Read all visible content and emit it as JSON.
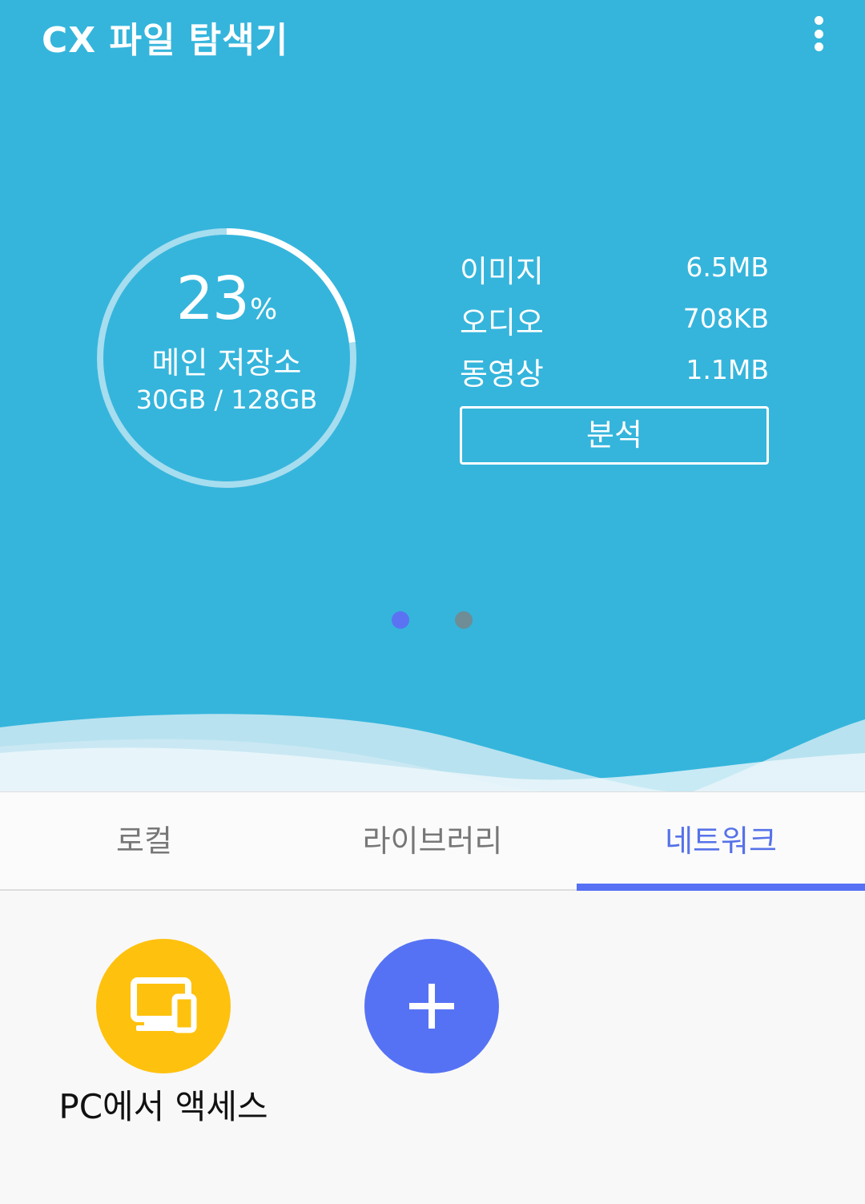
{
  "app": {
    "title": "CX 파일 탐색기"
  },
  "storage": {
    "percent": "23",
    "percent_sign": "%",
    "used_fraction": 0.23,
    "name": "메인 저장소",
    "size": "30GB / 128GB"
  },
  "stats": [
    {
      "label": "이미지",
      "value": "6.5MB"
    },
    {
      "label": "오디오",
      "value": "708KB"
    },
    {
      "label": "동영상",
      "value": "1.1MB"
    }
  ],
  "analyze_label": "분석",
  "pager": {
    "pages": 2,
    "active_index": 0
  },
  "tabs": [
    {
      "label": "로컬"
    },
    {
      "label": "라이브러리"
    },
    {
      "label": "네트워크"
    }
  ],
  "active_tab_index": 2,
  "network": {
    "items": [
      {
        "label": "PC에서 액세스",
        "icon": "pc-device-icon",
        "color": "#fec10e"
      },
      {
        "label": "",
        "icon": "plus-icon",
        "color": "#5672f4"
      }
    ]
  },
  "colors": {
    "primary": "#35b5dc",
    "accent": "#5671f3",
    "pc_button": "#fec10e",
    "add_button": "#5672f4",
    "pager_active": "#5b73f2",
    "pager_inactive": "#6e8d96"
  }
}
